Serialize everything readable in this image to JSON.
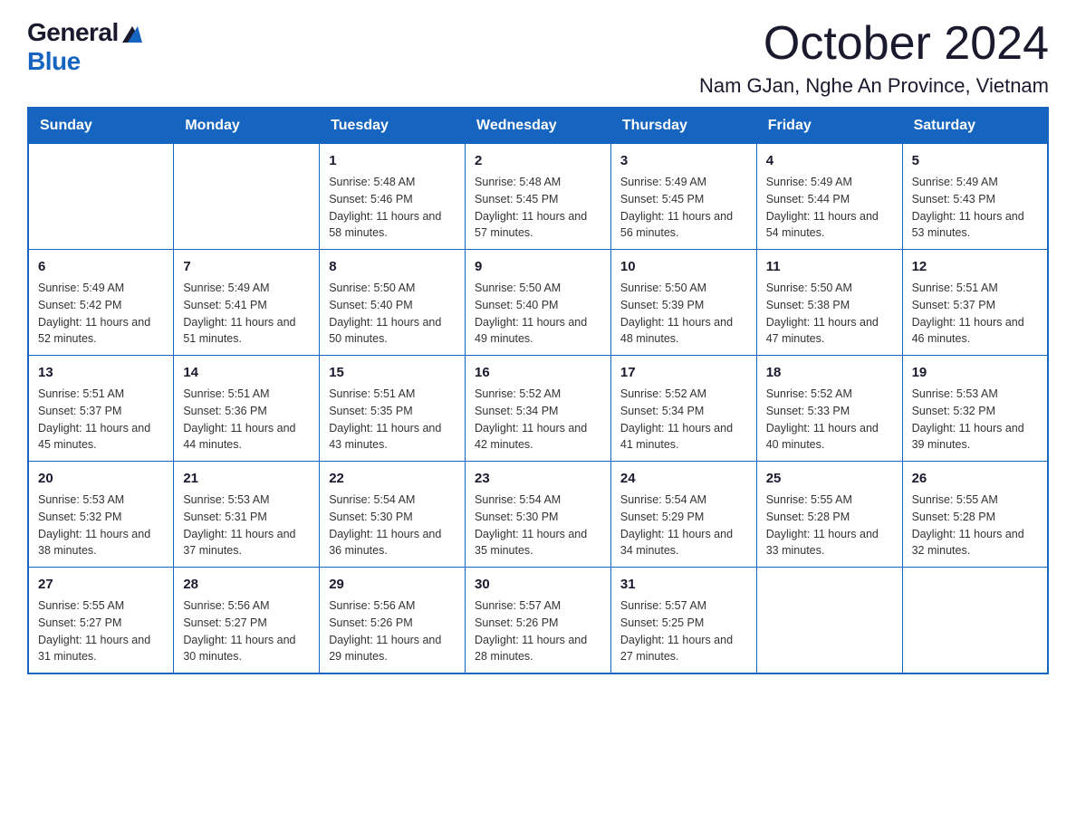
{
  "header": {
    "logo_general": "General",
    "logo_blue": "Blue",
    "month_title": "October 2024",
    "location": "Nam GJan, Nghe An Province, Vietnam"
  },
  "days_of_week": [
    "Sunday",
    "Monday",
    "Tuesday",
    "Wednesday",
    "Thursday",
    "Friday",
    "Saturday"
  ],
  "weeks": [
    [
      null,
      null,
      {
        "day": "1",
        "sunrise": "5:48 AM",
        "sunset": "5:46 PM",
        "daylight": "11 hours and 58 minutes."
      },
      {
        "day": "2",
        "sunrise": "5:48 AM",
        "sunset": "5:45 PM",
        "daylight": "11 hours and 57 minutes."
      },
      {
        "day": "3",
        "sunrise": "5:49 AM",
        "sunset": "5:45 PM",
        "daylight": "11 hours and 56 minutes."
      },
      {
        "day": "4",
        "sunrise": "5:49 AM",
        "sunset": "5:44 PM",
        "daylight": "11 hours and 54 minutes."
      },
      {
        "day": "5",
        "sunrise": "5:49 AM",
        "sunset": "5:43 PM",
        "daylight": "11 hours and 53 minutes."
      }
    ],
    [
      {
        "day": "6",
        "sunrise": "5:49 AM",
        "sunset": "5:42 PM",
        "daylight": "11 hours and 52 minutes."
      },
      {
        "day": "7",
        "sunrise": "5:49 AM",
        "sunset": "5:41 PM",
        "daylight": "11 hours and 51 minutes."
      },
      {
        "day": "8",
        "sunrise": "5:50 AM",
        "sunset": "5:40 PM",
        "daylight": "11 hours and 50 minutes."
      },
      {
        "day": "9",
        "sunrise": "5:50 AM",
        "sunset": "5:40 PM",
        "daylight": "11 hours and 49 minutes."
      },
      {
        "day": "10",
        "sunrise": "5:50 AM",
        "sunset": "5:39 PM",
        "daylight": "11 hours and 48 minutes."
      },
      {
        "day": "11",
        "sunrise": "5:50 AM",
        "sunset": "5:38 PM",
        "daylight": "11 hours and 47 minutes."
      },
      {
        "day": "12",
        "sunrise": "5:51 AM",
        "sunset": "5:37 PM",
        "daylight": "11 hours and 46 minutes."
      }
    ],
    [
      {
        "day": "13",
        "sunrise": "5:51 AM",
        "sunset": "5:37 PM",
        "daylight": "11 hours and 45 minutes."
      },
      {
        "day": "14",
        "sunrise": "5:51 AM",
        "sunset": "5:36 PM",
        "daylight": "11 hours and 44 minutes."
      },
      {
        "day": "15",
        "sunrise": "5:51 AM",
        "sunset": "5:35 PM",
        "daylight": "11 hours and 43 minutes."
      },
      {
        "day": "16",
        "sunrise": "5:52 AM",
        "sunset": "5:34 PM",
        "daylight": "11 hours and 42 minutes."
      },
      {
        "day": "17",
        "sunrise": "5:52 AM",
        "sunset": "5:34 PM",
        "daylight": "11 hours and 41 minutes."
      },
      {
        "day": "18",
        "sunrise": "5:52 AM",
        "sunset": "5:33 PM",
        "daylight": "11 hours and 40 minutes."
      },
      {
        "day": "19",
        "sunrise": "5:53 AM",
        "sunset": "5:32 PM",
        "daylight": "11 hours and 39 minutes."
      }
    ],
    [
      {
        "day": "20",
        "sunrise": "5:53 AM",
        "sunset": "5:32 PM",
        "daylight": "11 hours and 38 minutes."
      },
      {
        "day": "21",
        "sunrise": "5:53 AM",
        "sunset": "5:31 PM",
        "daylight": "11 hours and 37 minutes."
      },
      {
        "day": "22",
        "sunrise": "5:54 AM",
        "sunset": "5:30 PM",
        "daylight": "11 hours and 36 minutes."
      },
      {
        "day": "23",
        "sunrise": "5:54 AM",
        "sunset": "5:30 PM",
        "daylight": "11 hours and 35 minutes."
      },
      {
        "day": "24",
        "sunrise": "5:54 AM",
        "sunset": "5:29 PM",
        "daylight": "11 hours and 34 minutes."
      },
      {
        "day": "25",
        "sunrise": "5:55 AM",
        "sunset": "5:28 PM",
        "daylight": "11 hours and 33 minutes."
      },
      {
        "day": "26",
        "sunrise": "5:55 AM",
        "sunset": "5:28 PM",
        "daylight": "11 hours and 32 minutes."
      }
    ],
    [
      {
        "day": "27",
        "sunrise": "5:55 AM",
        "sunset": "5:27 PM",
        "daylight": "11 hours and 31 minutes."
      },
      {
        "day": "28",
        "sunrise": "5:56 AM",
        "sunset": "5:27 PM",
        "daylight": "11 hours and 30 minutes."
      },
      {
        "day": "29",
        "sunrise": "5:56 AM",
        "sunset": "5:26 PM",
        "daylight": "11 hours and 29 minutes."
      },
      {
        "day": "30",
        "sunrise": "5:57 AM",
        "sunset": "5:26 PM",
        "daylight": "11 hours and 28 minutes."
      },
      {
        "day": "31",
        "sunrise": "5:57 AM",
        "sunset": "5:25 PM",
        "daylight": "11 hours and 27 minutes."
      },
      null,
      null
    ]
  ],
  "labels": {
    "sunrise_prefix": "Sunrise: ",
    "sunset_prefix": "Sunset: ",
    "daylight_prefix": "Daylight: "
  }
}
